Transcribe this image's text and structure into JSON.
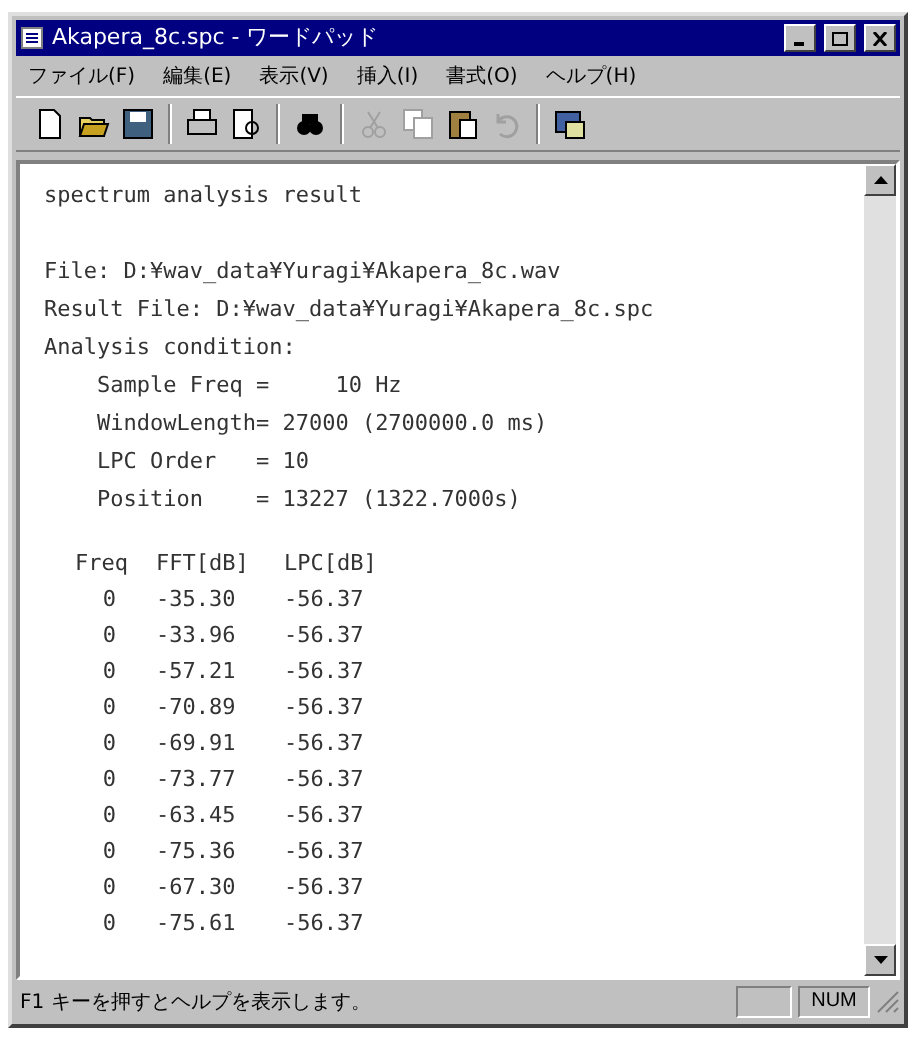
{
  "window": {
    "title": "Akapera_8c.spc - ワードパッド"
  },
  "menu": [
    "ファイル(F)",
    "編集(E)",
    "表示(V)",
    "挿入(I)",
    "書式(O)",
    "ヘルプ(H)"
  ],
  "toolbar": [
    {
      "kind": "new",
      "disabled": false
    },
    {
      "kind": "open",
      "disabled": false
    },
    {
      "kind": "save",
      "disabled": false
    },
    {
      "kind": "sep"
    },
    {
      "kind": "print",
      "disabled": false
    },
    {
      "kind": "preview",
      "disabled": false
    },
    {
      "kind": "sep"
    },
    {
      "kind": "find",
      "disabled": false
    },
    {
      "kind": "sep"
    },
    {
      "kind": "cut",
      "disabled": true
    },
    {
      "kind": "copy",
      "disabled": true
    },
    {
      "kind": "paste",
      "disabled": false
    },
    {
      "kind": "undo",
      "disabled": true
    },
    {
      "kind": "sep"
    },
    {
      "kind": "date",
      "disabled": false
    }
  ],
  "document": {
    "heading": "spectrum analysis result",
    "lines": [
      "File: D:¥wav_data¥Yuragi¥Akapera_8c.wav",
      "Result File: D:¥wav_data¥Yuragi¥Akapera_8c.spc",
      "Analysis condition:",
      "    Sample Freq =     10 Hz",
      "    WindowLength= 27000 (2700000.0 ms)",
      "    LPC Order   = 10",
      "    Position    = 13227 (1322.7000s)"
    ],
    "table": {
      "columns": [
        "Freq",
        "FFT[dB]",
        "LPC[dB]"
      ],
      "rows": [
        [
          "0",
          "-35.30",
          "-56.37"
        ],
        [
          "0",
          "-33.96",
          "-56.37"
        ],
        [
          "0",
          "-57.21",
          "-56.37"
        ],
        [
          "0",
          "-70.89",
          "-56.37"
        ],
        [
          "0",
          "-69.91",
          "-56.37"
        ],
        [
          "0",
          "-73.77",
          "-56.37"
        ],
        [
          "0",
          "-63.45",
          "-56.37"
        ],
        [
          "0",
          "-75.36",
          "-56.37"
        ],
        [
          "0",
          "-67.30",
          "-56.37"
        ],
        [
          "0",
          "-75.61",
          "-56.37"
        ]
      ]
    }
  },
  "status_bar": {
    "message": "F1 キーを押すとヘルプを表示します。",
    "indicator": "NUM"
  }
}
